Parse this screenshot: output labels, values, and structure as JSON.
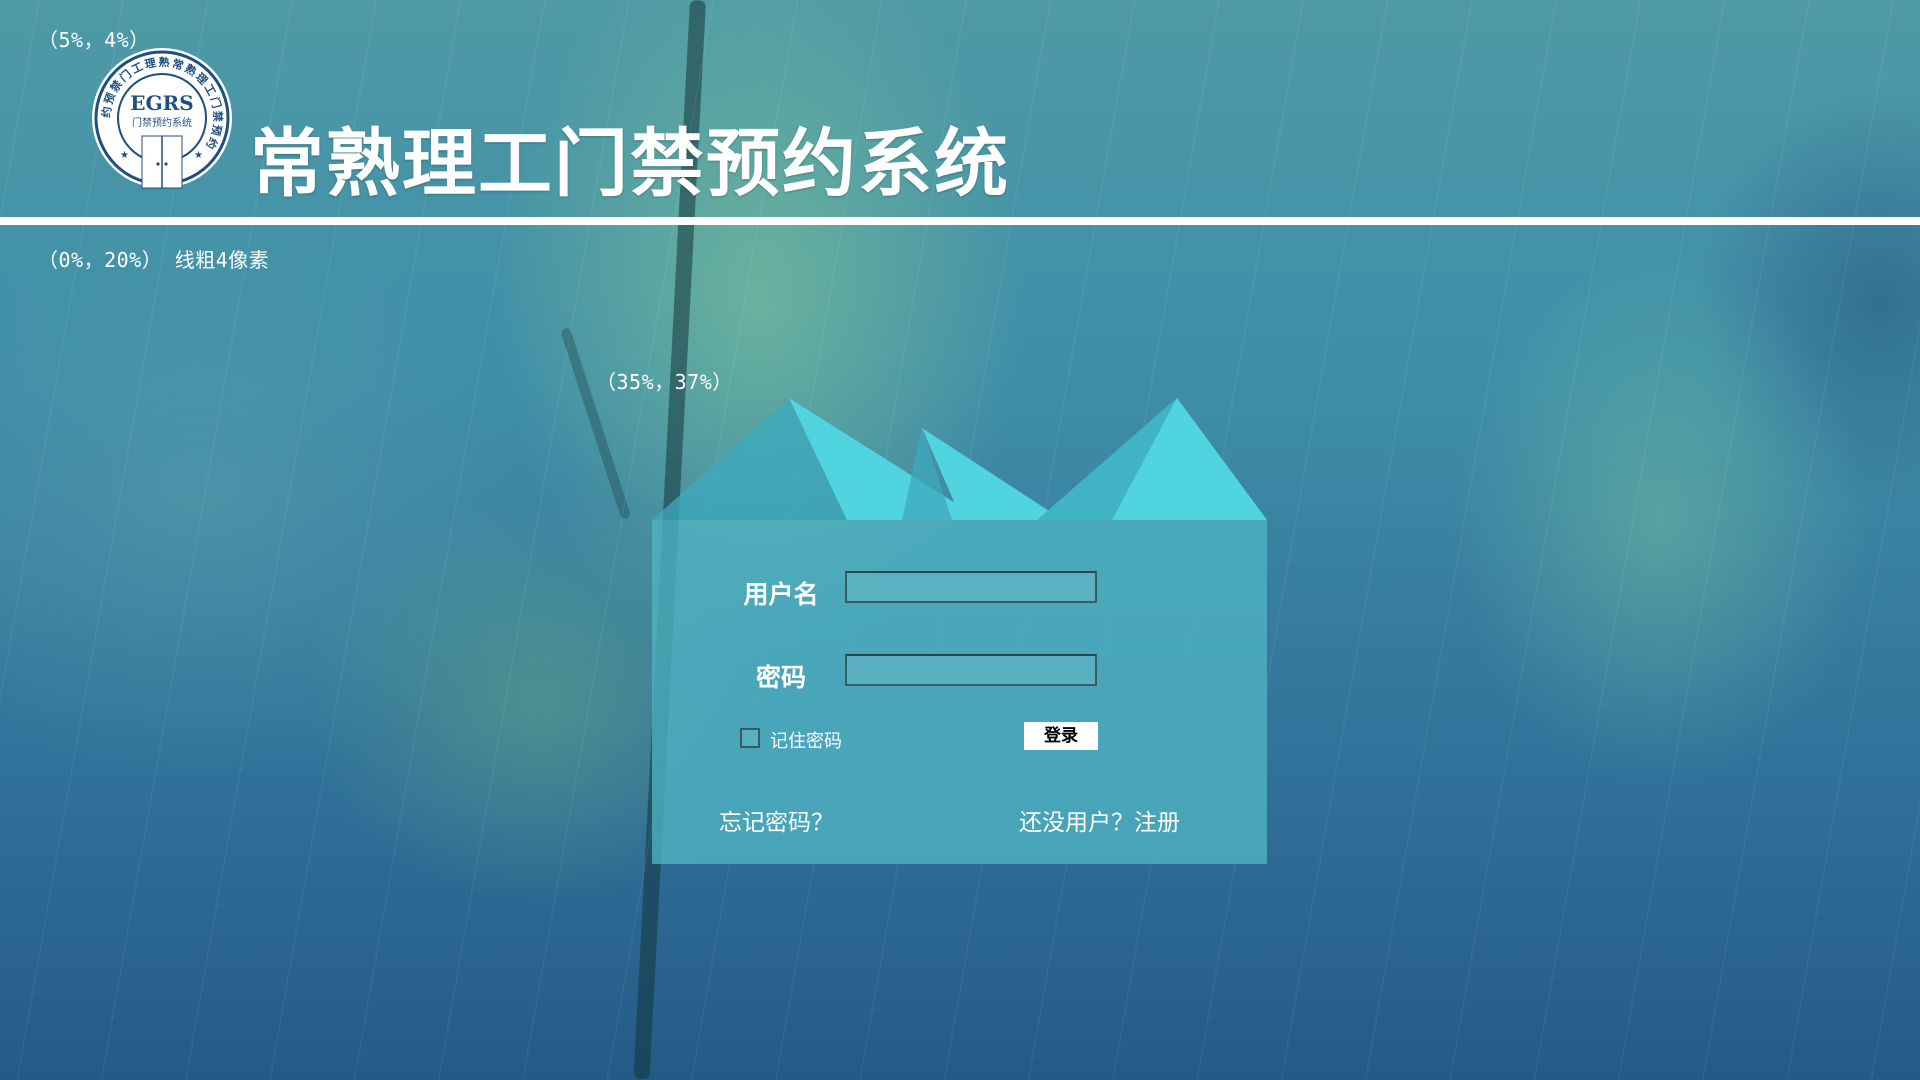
{
  "app": {
    "title": "常熟理工门禁预约系统",
    "logo": {
      "name": "egrs-seal-logo",
      "abbr": "EGRS",
      "subtitle": "门禁预约系统",
      "ring_text": "约预禁门工理熟常熟理工门禁预约"
    }
  },
  "annotations": {
    "logo_pos": "（5%，4%）",
    "rule_note": "（0%，20%） 线粗4像素",
    "panel_pos": "（35%，37%）"
  },
  "login": {
    "username_label": "用户名",
    "username_value": "",
    "password_label": "密码",
    "password_value": "",
    "remember_label": "记住密码",
    "remember_checked": false,
    "submit_label": "登录",
    "forgot_link": "忘记密码？",
    "register_link": "还没用户？注册"
  },
  "colors": {
    "panel": "#50b4c3",
    "roof": "#4fd4e0",
    "header_rule": "#ffffff",
    "seal_blue": "#1f4f7f"
  }
}
